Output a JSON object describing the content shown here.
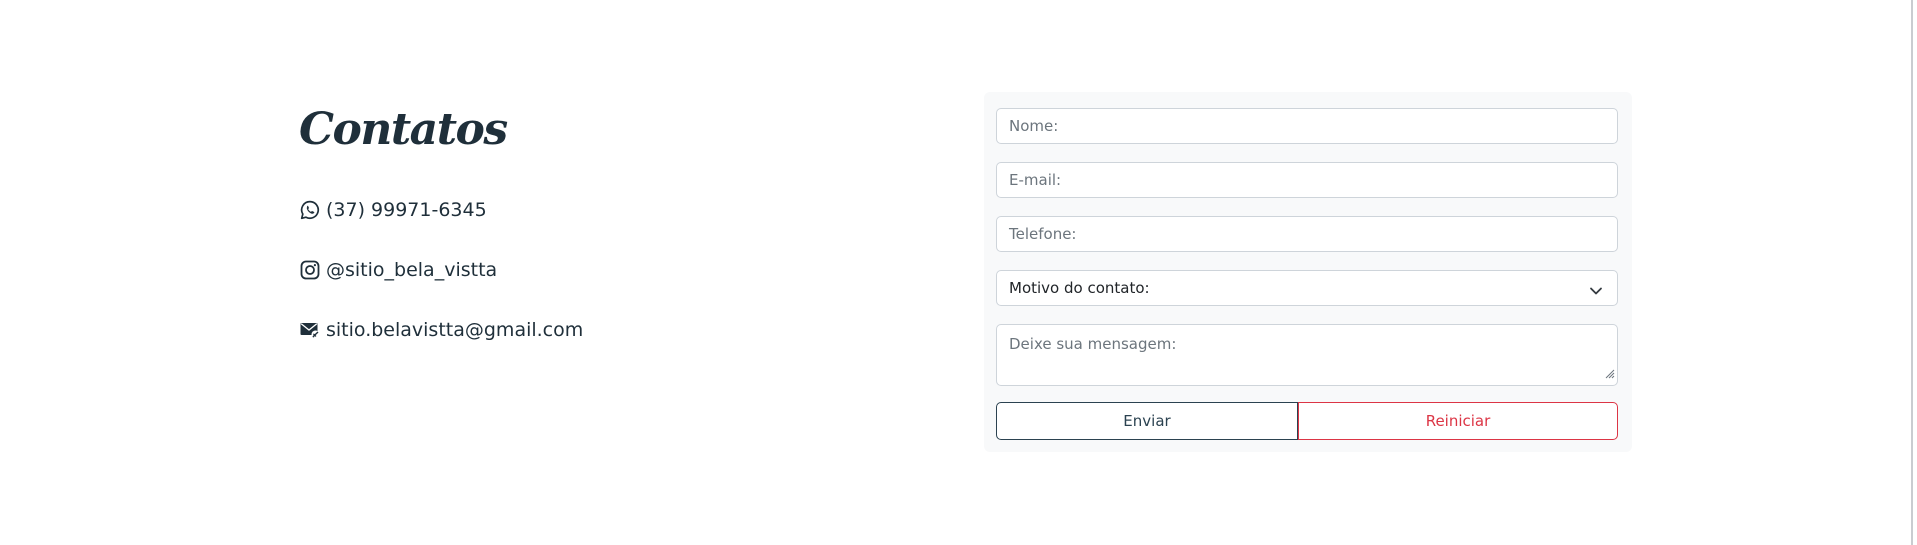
{
  "contacts": {
    "title": "Contatos",
    "phone": {
      "icon": "whatsapp-icon",
      "text": "(37) 99971-6345"
    },
    "instagram": {
      "icon": "instagram-icon",
      "text": "@sitio_bela_vistta"
    },
    "email": {
      "icon": "envelope-icon",
      "text": "sitio.belavistta@gmail.com"
    }
  },
  "form": {
    "name_placeholder": "Nome:",
    "email_placeholder": "E-mail:",
    "phone_placeholder": "Telefone:",
    "reason_selected": "Motivo do contato:",
    "message_placeholder": "Deixe sua mensagem:",
    "send_label": "Enviar",
    "reset_label": "Reiniciar"
  },
  "colors": {
    "text_dark": "#1f2f3a",
    "panel_bg": "#f8f9fa",
    "field_border": "#ced4da",
    "send_border": "#2b4250",
    "reset_red": "#dc3545"
  }
}
